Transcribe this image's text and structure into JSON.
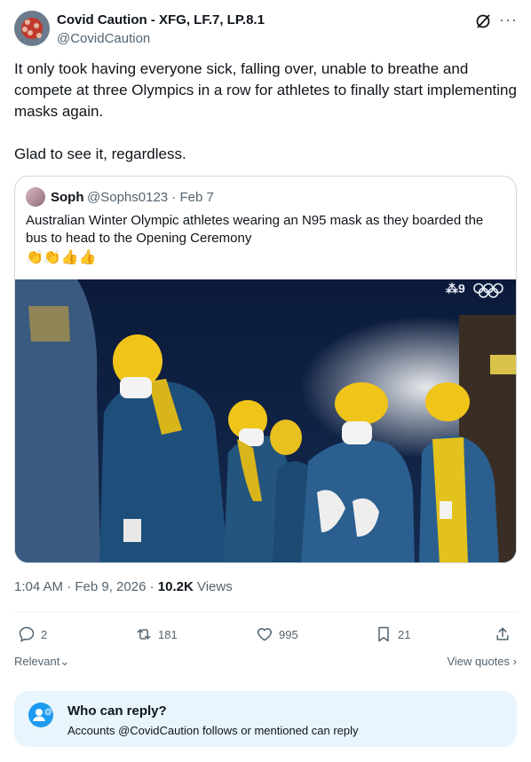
{
  "author": {
    "name": "Covid Caution - XFG, LF.7, LP.8.1",
    "handle": "@CovidCaution"
  },
  "tweet": {
    "paragraph1": "It only took having everyone sick, falling over, unable to breathe and compete at three Olympics in a row for athletes to finally start implementing masks again.",
    "paragraph2": "Glad to see it, regardless."
  },
  "quoted": {
    "name": "Soph",
    "meta": "@Sophs0123 · Feb 7",
    "text": "Australian Winter Olympic athletes wearing an N95 mask as they boarded the bus to head to the Opening Ceremony",
    "emoji": "👏👏👍👍"
  },
  "timestamp": {
    "time": "1:04 AM · Feb 9, 2026 · ",
    "views_count": "10.2K",
    "views_label": " Views"
  },
  "actions": {
    "replies": "2",
    "reposts": "181",
    "likes": "995",
    "bookmarks": "21"
  },
  "sort": {
    "relevant_label": "Relevant",
    "view_quotes_label": "View quotes"
  },
  "reply_settings": {
    "title": "Who can reply?",
    "subtitle": "Accounts @CovidCaution follows or mentioned can reply"
  },
  "colors": {
    "accent": "#1d9bf0",
    "secondary_text": "#536471",
    "reply_box_bg": "#e8f5fd"
  }
}
